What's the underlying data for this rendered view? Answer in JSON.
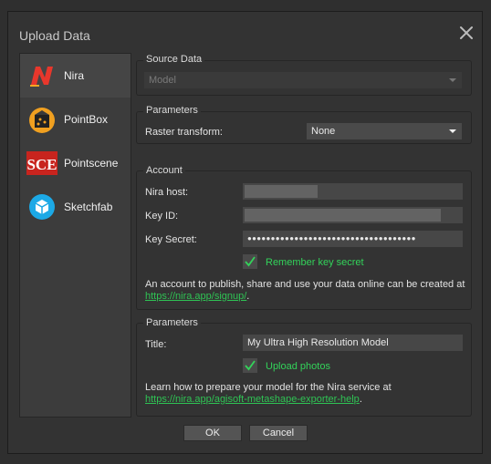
{
  "window": {
    "title": "Upload Data"
  },
  "sidebar": {
    "items": [
      {
        "label": "Nira",
        "icon": "nira-logo-icon",
        "active": true
      },
      {
        "label": "PointBox",
        "icon": "pointbox-logo-icon",
        "active": false
      },
      {
        "label": "Pointscene",
        "icon": "pointscene-logo-icon",
        "active": false
      },
      {
        "label": "Sketchfab",
        "icon": "sketchfab-logo-icon",
        "active": false
      }
    ]
  },
  "source_data": {
    "title": "Source Data",
    "select_value": "Model"
  },
  "parameters": {
    "title": "Parameters",
    "raster_label": "Raster transform:",
    "raster_value": "None"
  },
  "account": {
    "title": "Account",
    "host_label": "Nira host:",
    "key_id_label": "Key ID:",
    "key_secret_label": "Key Secret:",
    "key_secret_value": "●●●●●●●●●●●●●●●●●●●●●●●●●●●●●●●●●●●●",
    "remember_label": "Remember key secret",
    "remember_checked": true,
    "note_text": "An account to publish, share and use your data online can be created at",
    "note_link": "https://nira.app/signup/",
    "note_suffix": "."
  },
  "parameters2": {
    "title": "Parameters",
    "title_label": "Title:",
    "title_value": "My Ultra High Resolution Model",
    "upload_photos_label": "Upload photos",
    "upload_photos_checked": true,
    "note_text": "Learn how to prepare your model for the Nira service at",
    "note_link": "https://nira.app/agisoft-metashape-exporter-help",
    "note_suffix": "."
  },
  "buttons": {
    "ok": "OK",
    "cancel": "Cancel"
  },
  "colors": {
    "accent_green": "#33d35a",
    "nira_red": "#e8372c"
  }
}
